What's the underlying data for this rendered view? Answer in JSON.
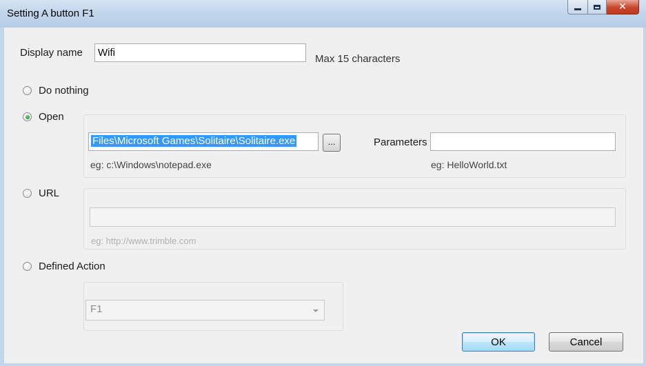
{
  "window": {
    "title": "Setting A button F1"
  },
  "display_name": {
    "label": "Display name",
    "value": "Wifi",
    "hint": "Max 15 characters"
  },
  "options": {
    "do_nothing": {
      "label": "Do nothing",
      "selected": false
    },
    "open": {
      "label": "Open",
      "selected": true,
      "path_value": "Files\\Microsoft Games\\Solitaire\\Solitaire.exe",
      "browse_label": "...",
      "path_hint": "eg: c:\\Windows\\notepad.exe",
      "parameters_label": "Parameters",
      "parameters_value": "",
      "parameters_hint": "eg: HelloWorld.txt"
    },
    "url": {
      "label": "URL",
      "selected": false,
      "value": "",
      "hint": "eg: http://www.trimble.com"
    },
    "defined_action": {
      "label": "Defined Action",
      "selected": false,
      "value": "F1"
    }
  },
  "buttons": {
    "ok": "OK",
    "cancel": "Cancel"
  },
  "colors": {
    "selection": "#3399ff",
    "ok_border": "#3c7fb1",
    "title_bar": "#c2d6ec"
  }
}
